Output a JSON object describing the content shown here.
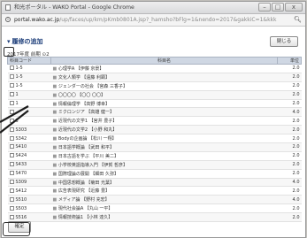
{
  "window": {
    "title": "和光ポータル - WAKO Portal - Google Chrome",
    "buttons": [
      "–",
      "□",
      "x"
    ]
  },
  "address_bar": {
    "host": "portal.wako.ac.jp",
    "path": "/up/faces/up/km/pKmb0801A.jsp?_hamsho?bFlg=1&nendo=2017&gakkiC=1&kkk",
    "zoom_icon": "magnifier-icon"
  },
  "page": {
    "heading": "履修の追加",
    "close_button": "閉じる",
    "year_line": "2017年度 前期 ⊙2",
    "confirm_button": "確定"
  },
  "table": {
    "headers": [
      "科目コード",
      "科目名",
      "単位"
    ],
    "rows": [
      {
        "code": "1-5",
        "name": "心理学A 【伊藤 京景】",
        "credit": "2.0"
      },
      {
        "code": "1-5",
        "name": "文化人類学 【遠藤 利顕】",
        "credit": "2.0"
      },
      {
        "code": "1-5",
        "name": "ジェンダーの社会 【宮森 三香子】",
        "credit": "2.0"
      },
      {
        "code": "1",
        "name": "〇〇〇〇 【〇〇 〇〇】",
        "credit": "2.0"
      },
      {
        "code": "1",
        "name": "情報倫理学 【高野 博幸】",
        "credit": "2.0"
      },
      {
        "code": "",
        "name": "ミクロンジア 【高雄 健一】",
        "credit": "4.0"
      },
      {
        "code": "3",
        "name": "近現代の文学1 【宮井 豊子】",
        "credit": "2.0"
      },
      {
        "code": "S303",
        "name": "近現代の文学2 【小野 和丸】",
        "credit": "2.0"
      },
      {
        "code": "S342",
        "name": "Bodyの企画論 【松川 一翔】",
        "credit": "2.0"
      },
      {
        "code": "S410",
        "name": "日本語学概論 【武田 和平】",
        "credit": "2.0"
      },
      {
        "code": "S424",
        "name": "日本古語を学ぶ 【平川 美二】",
        "credit": "2.0"
      },
      {
        "code": "S433",
        "name": "小学校英語指導入門 【伊賀 哲彦】",
        "credit": "2.0"
      },
      {
        "code": "S470",
        "name": "国際理論の展開 【細田 久弥】",
        "credit": "2.0"
      },
      {
        "code": "S309",
        "name": "中国思想概論 【菊田 光葉】",
        "credit": "4.0"
      },
      {
        "code": "S412",
        "name": "広告表現研究 【近藤 豊】",
        "credit": "2.0"
      },
      {
        "code": "S510",
        "name": "メディア論 【野村 充宏】",
        "credit": "4.0"
      },
      {
        "code": "S503",
        "name": "現代社会論A 【丸山 一平】",
        "credit": "2.0"
      },
      {
        "code": "S516",
        "name": "情報技術論1 【小林 達久】",
        "credit": "2.0"
      }
    ]
  }
}
